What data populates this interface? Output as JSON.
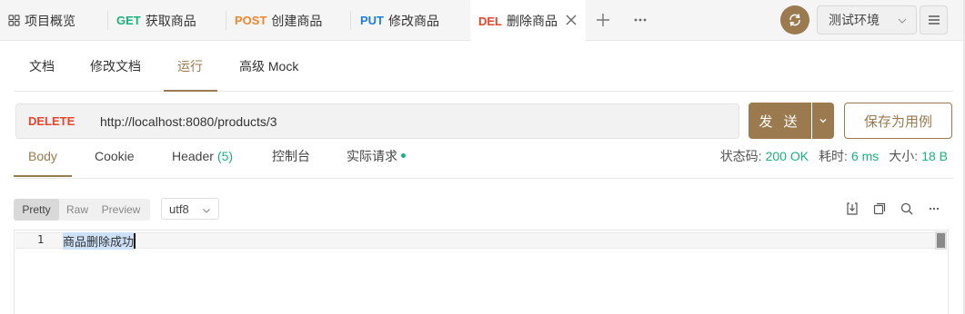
{
  "top_tabs": [
    {
      "label": "项目概览",
      "method": "",
      "icon": "grid-icon"
    },
    {
      "label": "获取商品",
      "method": "GET"
    },
    {
      "label": "创建商品",
      "method": "POST"
    },
    {
      "label": "修改商品",
      "method": "PUT"
    },
    {
      "label": "删除商品",
      "method": "DEL",
      "active": true
    }
  ],
  "environment": {
    "label": "测试环境"
  },
  "sub_tabs": [
    {
      "label": "文档"
    },
    {
      "label": "修改文档"
    },
    {
      "label": "运行",
      "active": true
    },
    {
      "label": "高级 Mock"
    }
  ],
  "request": {
    "method": "DELETE",
    "url": "http://localhost:8080/products/3",
    "send_label": "发 送",
    "save_label": "保存为用例"
  },
  "response_tabs": [
    {
      "label": "Body",
      "active": true
    },
    {
      "label": "Cookie"
    },
    {
      "label": "Header",
      "count": "(5)"
    },
    {
      "label": "控制台"
    },
    {
      "label": "实际请求",
      "dot": true
    }
  ],
  "stats": {
    "status_label": "状态码:",
    "status_value": "200 OK",
    "time_label": "耗时:",
    "time_value": "6 ms",
    "size_label": "大小:",
    "size_value": "18 B"
  },
  "view_modes": [
    "Pretty",
    "Raw",
    "Preview"
  ],
  "encoding": "utf8",
  "editor": {
    "line_number": "1",
    "content": "商品删除成功"
  },
  "colors": {
    "accent": "#9a7a4e",
    "get": "#19b27a",
    "post": "#f0862e",
    "put": "#1f7de0",
    "delete": "#e8452c"
  }
}
